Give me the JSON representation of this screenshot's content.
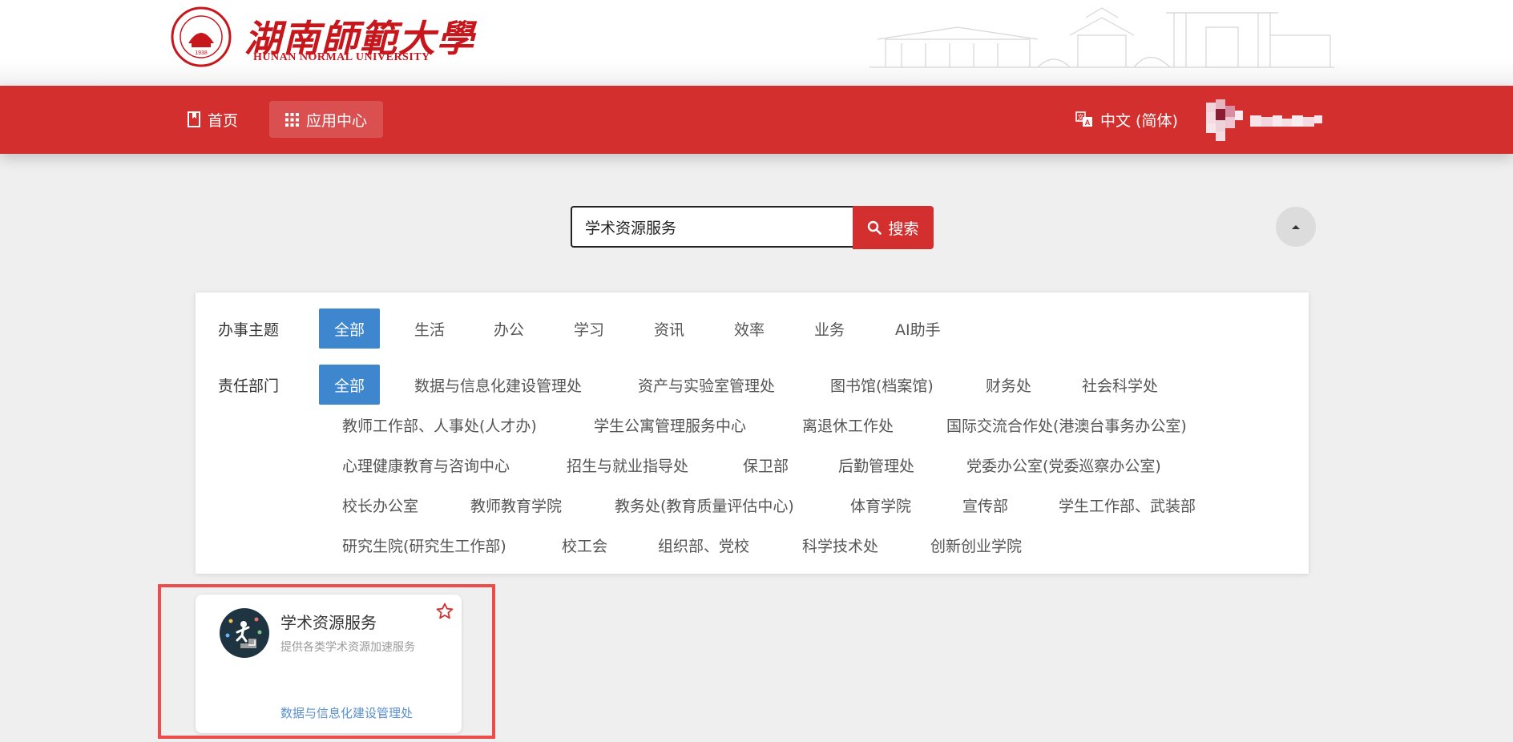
{
  "header": {
    "logo_cn": "湖南師範大學",
    "logo_en": "HUNAN NORMAL UNIVERSITY"
  },
  "nav": {
    "home": "首页",
    "app_center": "应用中心",
    "language": "中文 (简体)"
  },
  "search": {
    "value": "学术资源服务",
    "button": "搜索"
  },
  "filters": {
    "topic_label": "办事主题",
    "topics": [
      "全部",
      "生活",
      "办公",
      "学习",
      "资讯",
      "效率",
      "业务",
      "AI助手"
    ],
    "dept_label": "责任部门",
    "departments": [
      "全部",
      "数据与信息化建设管理处",
      "资产与实验室管理处",
      "图书馆(档案馆)",
      "财务处",
      "社会科学处",
      "教师工作部、人事处(人才办)",
      "学生公寓管理服务中心",
      "离退休工作处",
      "国际交流合作处(港澳台事务办公室)",
      "心理健康教育与咨询中心",
      "招生与就业指导处",
      "保卫部",
      "后勤管理处",
      "党委办公室(党委巡察办公室)",
      "校长办公室",
      "教师教育学院",
      "教务处(教育质量评估中心)",
      "体育学院",
      "宣传部",
      "学生工作部、武装部",
      "研究生院(研究生工作部)",
      "校工会",
      "组织部、党校",
      "科学技术处",
      "创新创业学院"
    ]
  },
  "result": {
    "title": "学术资源服务",
    "description": "提供各类学术资源加速服务",
    "department": "数据与信息化建设管理处"
  },
  "colors": {
    "brand_red": "#d32f2f",
    "active_blue": "#3e86cd",
    "highlight": "#ee4b4b"
  }
}
